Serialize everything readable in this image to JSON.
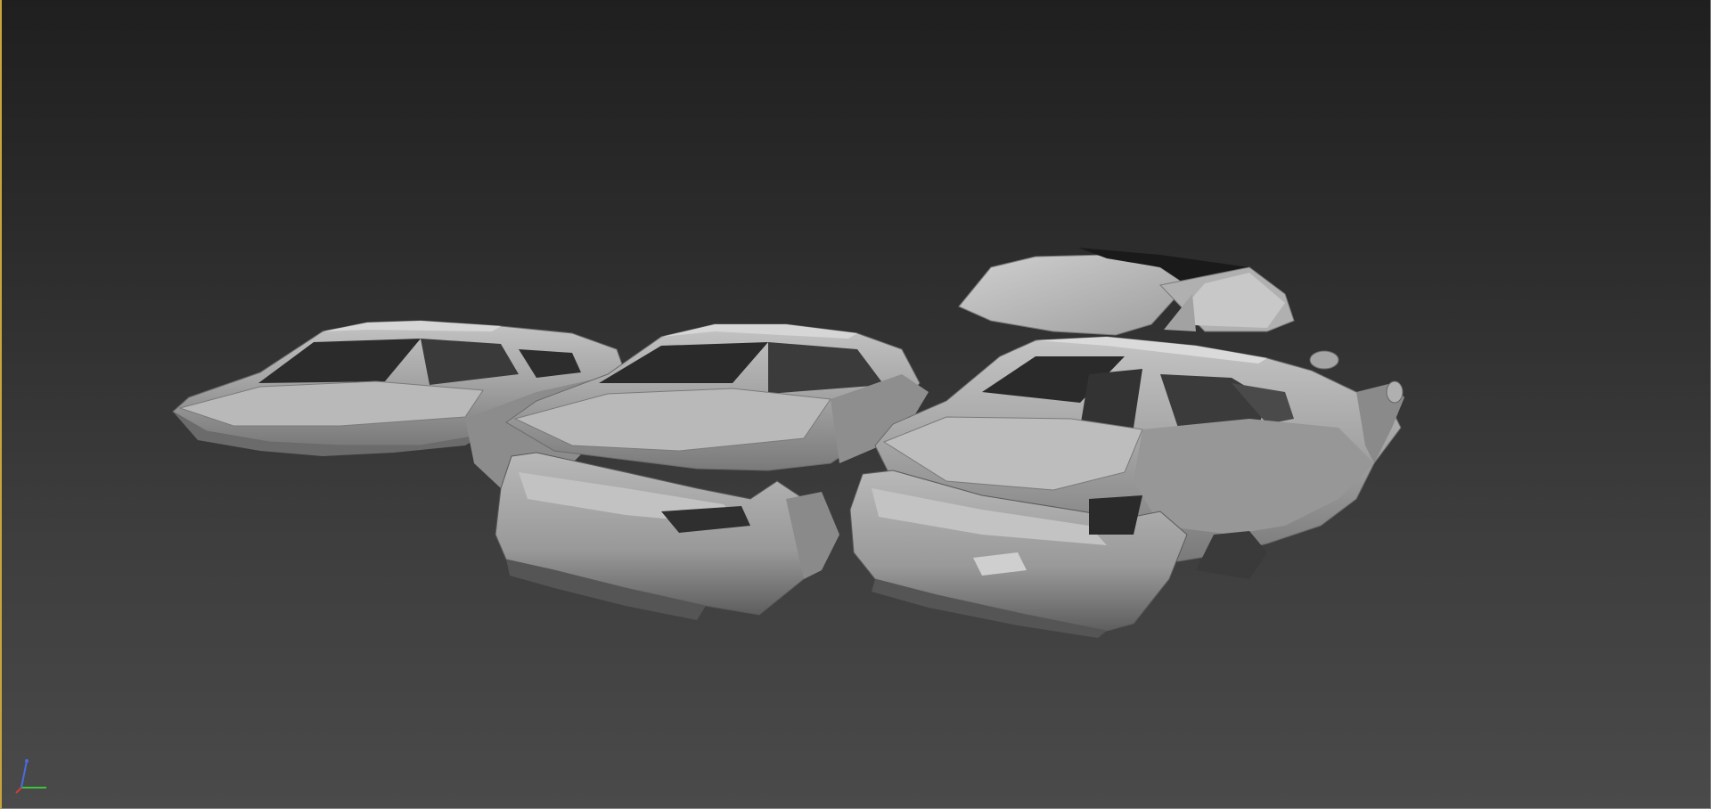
{
  "viewport": {
    "mode": "3d-perspective",
    "shading": "shaded",
    "background_top": "#1f1f1f",
    "background_bottom": "#4a4a4a",
    "active_border_color": "#c8a53a"
  },
  "scene": {
    "model_color": "#9a9a9a",
    "highlight_color": "#c9c9c9",
    "shadow_color": "#202020",
    "objects": [
      "car-shell-left",
      "car-shell-middle",
      "car-shell-right",
      "detached-glass-roof",
      "rear-bumper-middle",
      "rear-bumper-right"
    ]
  },
  "axis_gizmo": {
    "x_color": "#d23c3c",
    "y_color": "#3cc43c",
    "z_color": "#4a6ae0"
  }
}
